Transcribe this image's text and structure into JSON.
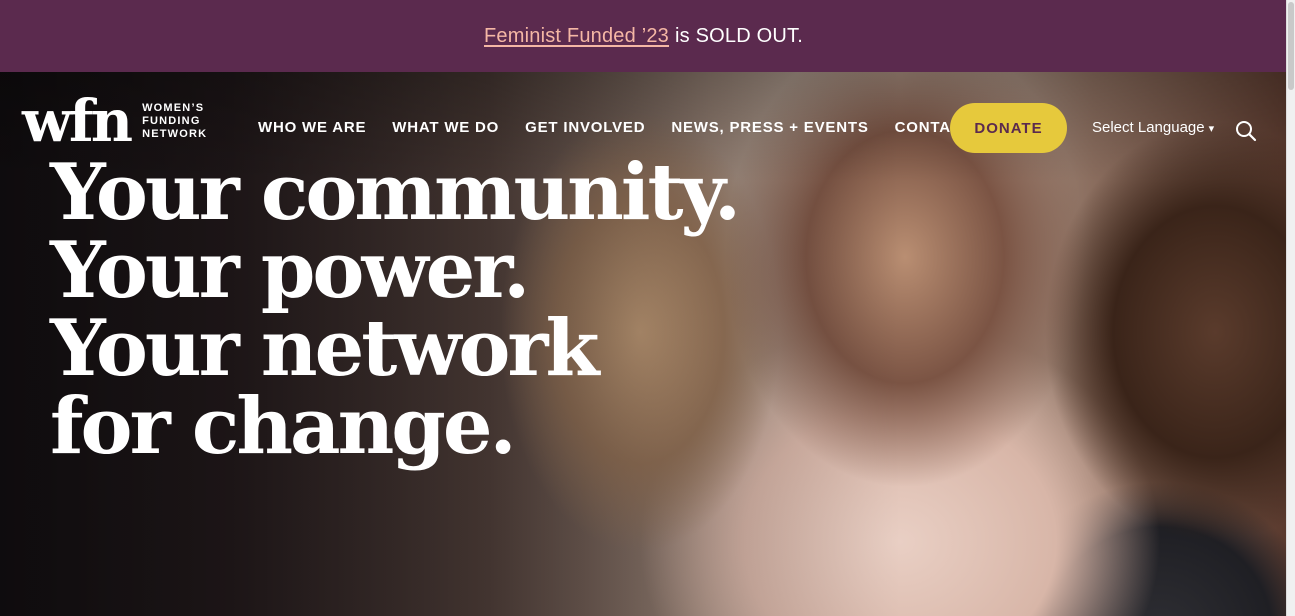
{
  "banner": {
    "link_text": "Feminist Funded ’23",
    "rest_text": "is SOLD OUT."
  },
  "logo": {
    "mark": "wfn",
    "line1": "WOMEN’S",
    "line2": "FUNDING",
    "line3": "NETWORK"
  },
  "nav": {
    "items": [
      {
        "label": "WHO WE ARE"
      },
      {
        "label": "WHAT WE DO"
      },
      {
        "label": "GET INVOLVED"
      },
      {
        "label": "NEWS, PRESS + EVENTS"
      },
      {
        "label": "CONTACT"
      }
    ],
    "donate_label": "DONATE",
    "language_label": "Select Language",
    "search_icon": "search-icon"
  },
  "hero": {
    "lines": [
      "Your community.",
      "Your power.",
      "Your network",
      "for change."
    ]
  },
  "colors": {
    "banner_bg": "#5b2a4e",
    "banner_link": "#f5b7a5",
    "donate_bg": "#e6c93c",
    "donate_text": "#5b2a4e"
  }
}
